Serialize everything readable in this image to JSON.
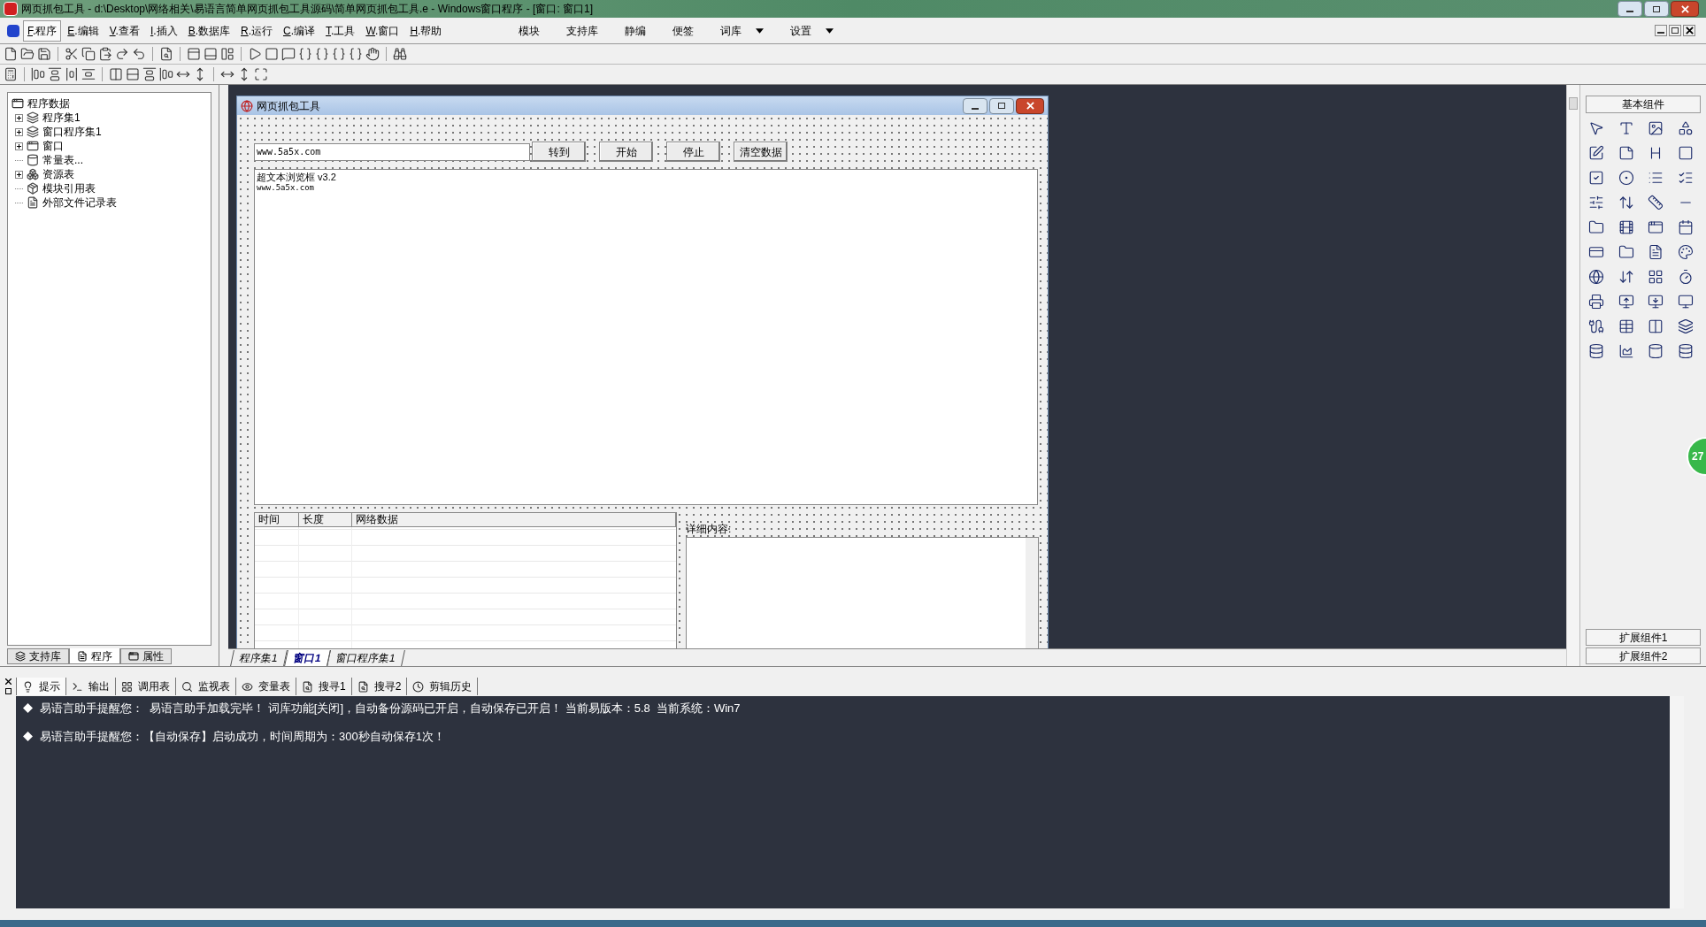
{
  "window": {
    "title": "网页抓包工具 - d:\\Desktop\\网络相关\\易语言简单网页抓包工具源码\\简单网页抓包工具.e - Windows窗口程序 - [窗口: 窗口1]"
  },
  "menu": [
    {
      "key": "F",
      "label": ".程序",
      "selected": true
    },
    {
      "key": "E",
      "label": ".编辑",
      "selected": false
    },
    {
      "key": "V",
      "label": ".查看",
      "selected": false
    },
    {
      "key": "I",
      "label": ".插入",
      "selected": false
    },
    {
      "key": "B",
      "label": ".数据库",
      "selected": false
    },
    {
      "key": "R",
      "label": ".运行",
      "selected": false
    },
    {
      "key": "C",
      "label": ".编译",
      "selected": false
    },
    {
      "key": "T",
      "label": ".工具",
      "selected": false
    },
    {
      "key": "W",
      "label": ".窗口",
      "selected": false
    },
    {
      "key": "H",
      "label": ".帮助",
      "selected": false
    }
  ],
  "extra_menu": [
    {
      "label": "模块",
      "dropdown": false
    },
    {
      "label": "支持库",
      "dropdown": false
    },
    {
      "label": "静编",
      "dropdown": false
    },
    {
      "label": "便签",
      "dropdown": false
    },
    {
      "label": "词库",
      "dropdown": true
    },
    {
      "label": "设置",
      "dropdown": true
    }
  ],
  "tree": {
    "root": "程序数据",
    "children": [
      {
        "label": "程序集1",
        "expanded": false
      },
      {
        "label": "窗口程序集1",
        "expanded": false
      },
      {
        "label": "窗口",
        "expanded": false
      },
      {
        "label": "常量表..."
      },
      {
        "label": "资源表",
        "expanded": false
      },
      {
        "label": "模块引用表"
      },
      {
        "label": "外部文件记录表"
      }
    ]
  },
  "left_tabs": [
    {
      "label": "支持库",
      "selected": false
    },
    {
      "label": "程序",
      "selected": true
    },
    {
      "label": "属性",
      "selected": false
    }
  ],
  "form": {
    "title": "网页抓包工具",
    "url_value": "www.5a5x.com",
    "buttons": [
      "转到",
      "开始",
      "停止",
      "清空数据"
    ],
    "browser_lines": [
      "超文本浏览框 v3.2",
      "www.5a5x.com"
    ],
    "list_columns": [
      "时间",
      "长度",
      "网络数据"
    ],
    "detail_label": "详细内容:"
  },
  "doc_tabs": [
    {
      "label": "程序集1",
      "selected": false
    },
    {
      "label": "窗口1",
      "selected": true
    },
    {
      "label": "窗口程序集1",
      "selected": false
    }
  ],
  "toolbox": {
    "title": "基本组件",
    "extensions": [
      "扩展组件1",
      "扩展组件2"
    ]
  },
  "floating_badge": "27",
  "output_tabs": [
    {
      "label": "提示",
      "selected": true
    },
    {
      "label": "输出",
      "selected": false
    },
    {
      "label": "调用表",
      "selected": false
    },
    {
      "label": "监视表",
      "selected": false
    },
    {
      "label": "变量表",
      "selected": false
    },
    {
      "label": "搜寻1",
      "selected": false
    },
    {
      "label": "搜寻2",
      "selected": false
    },
    {
      "label": "剪辑历史",
      "selected": false
    }
  ],
  "messages": [
    "易语言助手提醒您：  易语言助手加载完毕！ 词库功能[关闭]，自动备份源码已开启，自动保存已开启！ 当前易版本：5.8  当前系统：Win7",
    "易语言助手提醒您：【自动保存】启动成功，时间周期为：300秒自动保存1次！"
  ]
}
